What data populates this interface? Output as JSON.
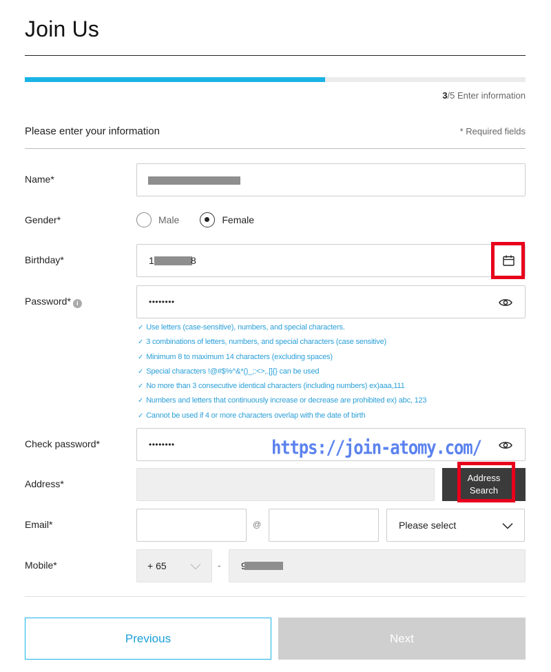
{
  "page": {
    "title": "Join Us"
  },
  "progress": {
    "fraction": 0.6,
    "step_current": "3",
    "step_rest": "/5 Enter information"
  },
  "section": {
    "title": "Please enter your information",
    "required_note": "* Required fields"
  },
  "fields": {
    "name": {
      "label": "Name*"
    },
    "gender": {
      "label": "Gender*",
      "options": [
        "Male",
        "Female"
      ],
      "selected": "Female"
    },
    "birthday": {
      "label": "Birthday*",
      "value_start": "1",
      "value_end": "8"
    },
    "password": {
      "label": "Password*",
      "value": "••••••••",
      "rules": [
        "Use letters (case-sensitive), numbers, and special characters.",
        "3 combinations of letters, numbers, and special characters (case sensitive)",
        "Minimum 8 to maximum 14 characters (excluding spaces)",
        "Special characters !@#$%^&*()_;:<>,.[]{} can be used",
        "No more than 3 consecutive identical characters (including numbers) ex)aaa,111",
        "Numbers and letters that continuously increase or decrease are prohibited ex) abc, 123",
        "Cannot be used if 4 or more characters overlap with the date of birth"
      ]
    },
    "check_password": {
      "label": "Check password*",
      "value": "••••••••"
    },
    "address": {
      "label": "Address*",
      "button_line1": "Address",
      "button_line2": "Search"
    },
    "email": {
      "label": "Email*",
      "at": "@",
      "domain_select": "Please select"
    },
    "mobile": {
      "label": "Mobile*",
      "country_code": "+ 65",
      "separator": "-",
      "value_start": "9"
    }
  },
  "watermark": "https://join-atomy.com/",
  "buttons": {
    "previous": "Previous",
    "next": "Next"
  },
  "colors": {
    "accent": "#1ab3e6",
    "highlight": "#e8001c",
    "rule_text": "#2a9fd8",
    "watermark": "#5b82ee"
  }
}
